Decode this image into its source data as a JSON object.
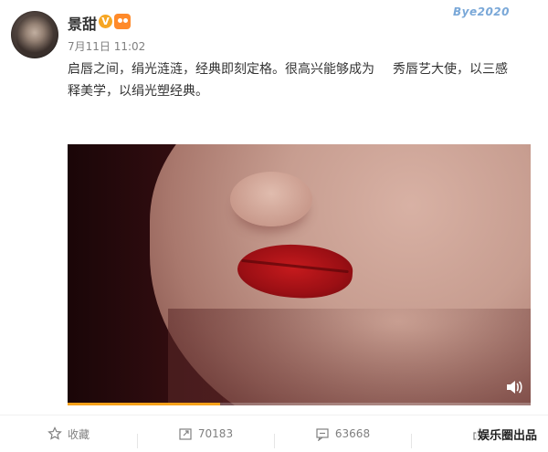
{
  "post": {
    "author_name": "景甜",
    "verified_badge": "V",
    "timestamp": "7月11日 11:02",
    "text_line1": "启唇之间，绢光涟涟，经典即刻定格。很高兴能够成为",
    "text_line1_tail": "秀唇艺大使，以三感",
    "text_line2": "释美学，以绢光塑经典。"
  },
  "watermark": "Bye2020",
  "video": {
    "progress_fraction": 0.33
  },
  "actions": {
    "favorite_label": "收藏",
    "repost_count": "70183",
    "comment_count": "63668",
    "like_label": "娱乐圈出品"
  },
  "colors": {
    "accent_orange": "#f7a11a",
    "verified_badge": "#f6a623",
    "text_gray": "#808080"
  },
  "icons": [
    "avatar",
    "verified-icon",
    "member-icon",
    "volume-icon",
    "star-icon",
    "repost-icon",
    "comment-icon",
    "like-icon"
  ]
}
